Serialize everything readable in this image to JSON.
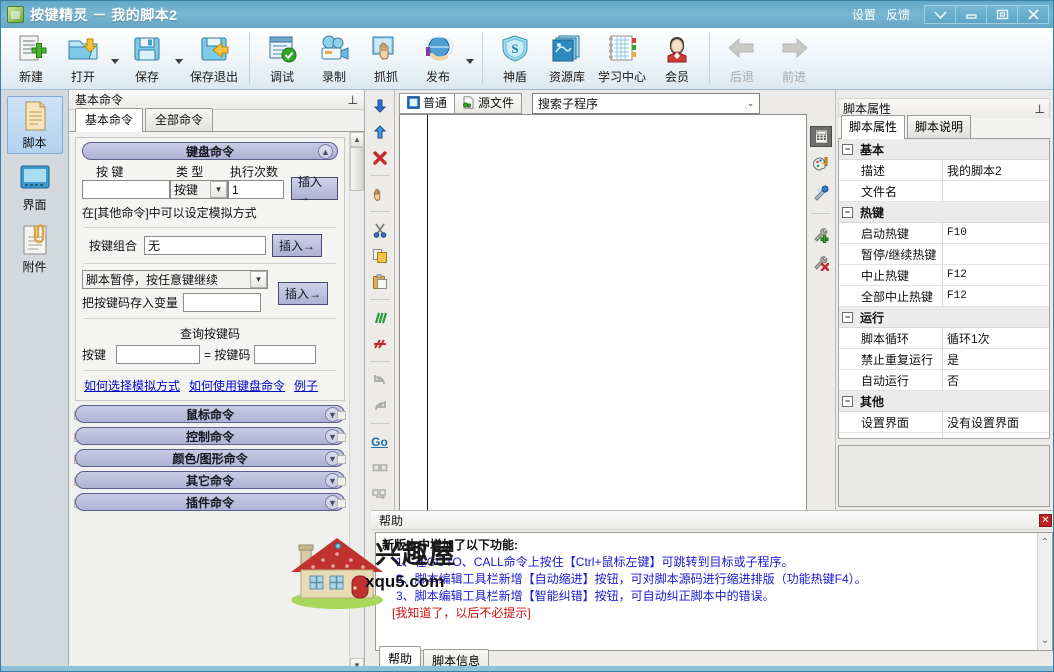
{
  "window": {
    "app_icon": "app-icon",
    "title": "按键精灵 － 我的脚本2",
    "settings_label": "设置",
    "feedback_label": "反馈",
    "btn_dropdown": "▽",
    "btn_minimize": "—",
    "btn_restore": "❐",
    "btn_close": "✕"
  },
  "toolbar": {
    "items": [
      {
        "label": "新建",
        "icon": "new-document-icon",
        "caret": false,
        "disabled": false
      },
      {
        "label": "打开",
        "icon": "open-folder-icon",
        "caret": true,
        "disabled": false
      },
      {
        "label": "保存",
        "icon": "save-disk-icon",
        "caret": true,
        "disabled": false
      },
      {
        "label": "保存退出",
        "icon": "save-exit-icon",
        "caret": false,
        "disabled": false
      },
      {
        "label": "调试",
        "icon": "debug-icon",
        "caret": false,
        "disabled": false
      },
      {
        "label": "录制",
        "icon": "record-camera-icon",
        "caret": false,
        "disabled": false
      },
      {
        "label": "抓抓",
        "icon": "grab-hand-icon",
        "caret": false,
        "disabled": false
      },
      {
        "label": "发布",
        "icon": "publish-globe-icon",
        "caret": true,
        "disabled": false
      },
      {
        "label": "神盾",
        "icon": "shield-icon",
        "caret": false,
        "disabled": false
      },
      {
        "label": "资源库",
        "icon": "resource-library-icon",
        "caret": false,
        "disabled": false
      },
      {
        "label": "学习中心",
        "icon": "learning-center-icon",
        "caret": false,
        "disabled": false
      },
      {
        "label": "会员",
        "icon": "member-avatar-icon",
        "caret": false,
        "disabled": false
      },
      {
        "label": "后退",
        "icon": "back-arrow-icon",
        "caret": false,
        "disabled": true
      },
      {
        "label": "前进",
        "icon": "forward-arrow-icon",
        "caret": false,
        "disabled": true
      }
    ]
  },
  "rail": {
    "items": [
      {
        "label": "脚本",
        "icon": "script-page-icon",
        "active": true
      },
      {
        "label": "界面",
        "icon": "interface-screen-icon",
        "active": false
      },
      {
        "label": "附件",
        "icon": "attachment-clip-icon",
        "active": false
      }
    ]
  },
  "command_dock": {
    "dock_title": "基本命令",
    "pin_icon": "pin-icon",
    "tabs": [
      {
        "label": "基本命令",
        "active": true
      },
      {
        "label": "全部命令",
        "active": false
      }
    ],
    "keyboard_group": {
      "title": "键盘命令",
      "collapse_icon": "chevron-up-circle-icon",
      "key_label": "按 键",
      "key_value": "",
      "type_label": "类 型",
      "type_value": "按键",
      "count_label": "执行次数",
      "count_value": "1",
      "insert_label": "插入→",
      "hint": "在[其他命令]中可以设定模拟方式",
      "combo_label": "按键组合",
      "combo_value": "无",
      "insert2_label": "插入→",
      "pause_value": "脚本暂停，按任意键继续",
      "store_label": "把按键码存入变量",
      "store_value": "",
      "insert3_label": "插入→",
      "query_title": "查询按键码",
      "query_key_label": "按键",
      "query_key_value": "",
      "query_eq_label": "= 按键码",
      "query_code_value": "",
      "links": [
        "如何选择模拟方式",
        "如何使用键盘命令",
        "例子"
      ]
    },
    "collapsed_groups": [
      {
        "title": "鼠标命令",
        "icon": "chevron-down-circle-icon"
      },
      {
        "title": "控制命令",
        "icon": "chevron-down-circle-icon"
      },
      {
        "title": "颜色/图形命令",
        "icon": "chevron-down-circle-icon"
      },
      {
        "title": "其它命令",
        "icon": "chevron-down-circle-icon"
      },
      {
        "title": "插件命令",
        "icon": "chevron-down-circle-icon"
      }
    ]
  },
  "vtools": {
    "items": [
      {
        "name": "move-down-icon",
        "glyph": "⇩",
        "color": "#2b5fc4",
        "sep_after": false
      },
      {
        "name": "move-up-icon",
        "glyph": "⇧",
        "color": "#2b7fd4",
        "sep_after": false
      },
      {
        "name": "delete-x-icon",
        "glyph": "✖",
        "color": "#c02a2a",
        "sep_after": true
      },
      {
        "name": "hand-drag-icon",
        "glyph": "✋",
        "color": "#d8a05a",
        "sep_after": true
      },
      {
        "name": "cut-scissors-icon",
        "glyph": "✂",
        "color": "#3b6fbf",
        "sep_after": false
      },
      {
        "name": "copy-icon",
        "glyph": "❏",
        "color": "#c79b2a",
        "sep_after": false
      },
      {
        "name": "paste-icon",
        "glyph": "📋",
        "color": "#c79b2a",
        "sep_after": true
      },
      {
        "name": "comment-icon",
        "glyph": "///",
        "color": "#2a9a3a",
        "sep_after": false
      },
      {
        "name": "uncomment-icon",
        "glyph": "✖",
        "color": "#c02a2a",
        "sep_after": true
      },
      {
        "name": "undo-icon",
        "glyph": "↶",
        "color": "#9a9a96",
        "sep_after": false
      },
      {
        "name": "redo-icon",
        "glyph": "↷",
        "color": "#9a9a96",
        "sep_after": true
      },
      {
        "name": "goto-icon",
        "glyph": "Go",
        "color": "#1a6fa8",
        "sep_after": false
      },
      {
        "name": "find-icon",
        "glyph": "👓",
        "color": "#b0b0ac",
        "sep_after": false
      },
      {
        "name": "find-replace-icon",
        "glyph": "👓",
        "color": "#b0b0ac",
        "sep_after": true
      }
    ]
  },
  "editor": {
    "tabs": [
      {
        "label": "普通",
        "icon": "normal-view-icon",
        "active": true
      },
      {
        "label": "源文件",
        "icon": "source-file-icon",
        "active": false
      }
    ],
    "search": {
      "value": "搜索子程序",
      "placeholder": "搜索子程序",
      "caret_icon": "chevron-down-icon"
    },
    "code": "",
    "hscroll_left_icon": "scroll-left-icon",
    "hscroll_right_icon": "scroll-right-icon"
  },
  "right_tools": {
    "items": [
      {
        "name": "calculator-icon",
        "glyph": "▦",
        "selected": true,
        "sep_after": false
      },
      {
        "name": "color-palette-icon",
        "glyph": "🎨",
        "selected": false,
        "sep_after": false
      },
      {
        "name": "magic-wand-icon",
        "glyph": "✦",
        "selected": false,
        "sep_after": true
      },
      {
        "name": "add-tool-icon",
        "glyph": "🔧",
        "selected": false,
        "sep_after": false
      },
      {
        "name": "remove-tool-icon",
        "glyph": "🔧",
        "selected": false,
        "sep_after": false
      }
    ]
  },
  "properties": {
    "dock_title": "脚本属性",
    "pin_icon": "pin-icon",
    "tabs": [
      {
        "label": "脚本属性",
        "active": true
      },
      {
        "label": "脚本说明",
        "active": false
      }
    ],
    "groups": [
      {
        "name": "基本",
        "rows": [
          {
            "key": "描述",
            "value": "我的脚本2",
            "mono": false
          },
          {
            "key": "文件名",
            "value": "",
            "mono": false
          }
        ]
      },
      {
        "name": "热键",
        "rows": [
          {
            "key": "启动热键",
            "value": "F10",
            "mono": true
          },
          {
            "key": "暂停/继续热键",
            "value": "",
            "mono": true
          },
          {
            "key": "中止热键",
            "value": "F12",
            "mono": true
          },
          {
            "key": "全部中止热键",
            "value": "F12",
            "mono": true
          }
        ]
      },
      {
        "name": "运行",
        "rows": [
          {
            "key": "脚本循环",
            "value": "循环1次",
            "mono": false
          },
          {
            "key": "禁止重复运行",
            "value": "是",
            "mono": false
          },
          {
            "key": "自动运行",
            "value": "否",
            "mono": false
          }
        ]
      },
      {
        "name": "其他",
        "rows": [
          {
            "key": "设置界面",
            "value": "没有设置界面",
            "mono": false
          }
        ]
      }
    ],
    "description_text": ""
  },
  "help": {
    "title": "帮助",
    "close_icon": "close-icon",
    "lines": [
      {
        "text": "新版本中增加了以下功能:",
        "style": "title"
      },
      {
        "text": "1、在GOTO、CALL命令上按住【Ctrl+鼠标左键】可跳转到目标或子程序。",
        "style": "link"
      },
      {
        "text": "2、脚本编辑工具栏新增【自动缩进】按钮，可对脚本源码进行缩进排版（功能热键F4）。",
        "style": "link"
      },
      {
        "text": "3、脚本编辑工具栏新增【智能纠错】按钮，可自动纠正脚本中的错误。",
        "style": "link"
      },
      {
        "text": "[我知道了，以后不必提示]",
        "style": "red"
      }
    ],
    "scroll_up_icon": "chevron-up-icon",
    "scroll_down_icon": "chevron-down-icon",
    "tabs": [
      {
        "label": "帮助",
        "active": true
      },
      {
        "label": "脚本信息",
        "active": false
      }
    ]
  },
  "watermark": {
    "text": "兴趣屋",
    "url": "xqu5.com",
    "house_icon": "house-logo-icon"
  },
  "colors": {
    "titlebar": "#6aabca",
    "accent_purple": "#aeb2d4",
    "link_blue": "#0008c8",
    "help_blue": "#1a1ad0",
    "help_red": "#d01010"
  }
}
